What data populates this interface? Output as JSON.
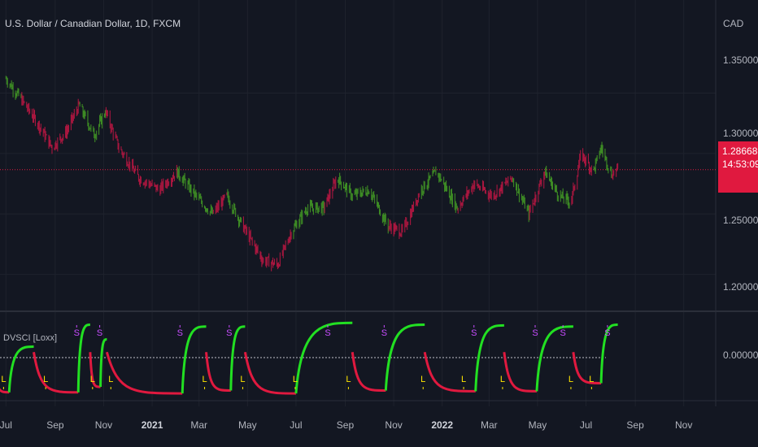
{
  "header": {
    "title": "U.S. Dollar / Canadian Dollar, 1D, FXCM",
    "currency": "CAD"
  },
  "indicator": {
    "title": "DVSCI [Loxx]",
    "sell_marker": "S",
    "buy_marker": "L"
  },
  "last_price": {
    "value": "1.28668",
    "countdown": "14:53:09",
    "color": "#e0193f"
  },
  "colors": {
    "background": "#131722",
    "bull": "#3d8b24",
    "bear": "#a8173f",
    "osc_bull": "#22e022",
    "osc_bear": "#e0193f",
    "sell_marker": "#c84cff",
    "buy_marker": "#ffe600"
  },
  "chart_data": [
    {
      "type": "ohlc",
      "title": "U.S. Dollar / Canadian Dollar, 1D, FXCM",
      "ylabel": "CAD",
      "ylim": [
        1.185,
        1.39
      ],
      "y_ticks": [
        "1.35000",
        "1.30000",
        "1.25000",
        "1.20000"
      ],
      "x_ticks": [
        {
          "label": "Jul",
          "bold": false
        },
        {
          "label": "Sep",
          "bold": false
        },
        {
          "label": "Nov",
          "bold": false
        },
        {
          "label": "2021",
          "bold": true
        },
        {
          "label": "Mar",
          "bold": false
        },
        {
          "label": "May",
          "bold": false
        },
        {
          "label": "Jul",
          "bold": false
        },
        {
          "label": "Sep",
          "bold": false
        },
        {
          "label": "Nov",
          "bold": false
        },
        {
          "label": "2022",
          "bold": true
        },
        {
          "label": "Mar",
          "bold": false
        },
        {
          "label": "May",
          "bold": false
        },
        {
          "label": "Jul",
          "bold": false
        },
        {
          "label": "Sep",
          "bold": false
        },
        {
          "label": "Nov",
          "bold": false
        }
      ],
      "last_value": 1.28668,
      "series_path": [
        [
          "2020-07-01",
          1.362,
          "bull"
        ],
        [
          "2020-07-20",
          1.345,
          "bear"
        ],
        [
          "2020-08-10",
          1.325,
          "bear"
        ],
        [
          "2020-08-28",
          1.305,
          "bear"
        ],
        [
          "2020-09-15",
          1.318,
          "bear"
        ],
        [
          "2020-10-01",
          1.34,
          "bull"
        ],
        [
          "2020-10-20",
          1.315,
          "bull"
        ],
        [
          "2020-11-03",
          1.335,
          "bear"
        ],
        [
          "2020-11-20",
          1.305,
          "bear"
        ],
        [
          "2020-12-15",
          1.28,
          "bear"
        ],
        [
          "2021-01-10",
          1.27,
          "bear"
        ],
        [
          "2021-02-01",
          1.285,
          "bull"
        ],
        [
          "2021-02-25",
          1.265,
          "bull"
        ],
        [
          "2021-03-18",
          1.25,
          "bear"
        ],
        [
          "2021-04-05",
          1.265,
          "bull"
        ],
        [
          "2021-04-25",
          1.24,
          "bear"
        ],
        [
          "2021-05-20",
          1.212,
          "bear"
        ],
        [
          "2021-06-08",
          1.208,
          "bear"
        ],
        [
          "2021-06-25",
          1.235,
          "bull"
        ],
        [
          "2021-07-15",
          1.255,
          "bull"
        ],
        [
          "2021-08-05",
          1.255,
          "bear"
        ],
        [
          "2021-08-22",
          1.28,
          "bull"
        ],
        [
          "2021-09-10",
          1.265,
          "bull"
        ],
        [
          "2021-10-01",
          1.27,
          "bull"
        ],
        [
          "2021-10-25",
          1.24,
          "bear"
        ],
        [
          "2021-11-12",
          1.235,
          "bear"
        ],
        [
          "2021-12-05",
          1.27,
          "bull"
        ],
        [
          "2021-12-25",
          1.285,
          "bull"
        ],
        [
          "2022-01-20",
          1.255,
          "bear"
        ],
        [
          "2022-02-10",
          1.275,
          "bear"
        ],
        [
          "2022-03-05",
          1.265,
          "bear"
        ],
        [
          "2022-03-30",
          1.28,
          "bull"
        ],
        [
          "2022-04-20",
          1.25,
          "bear"
        ],
        [
          "2022-05-10",
          1.285,
          "bull"
        ],
        [
          "2022-05-28",
          1.265,
          "bull"
        ],
        [
          "2022-06-12",
          1.26,
          "bear"
        ],
        [
          "2022-06-25",
          1.3,
          "bear"
        ],
        [
          "2022-07-10",
          1.285,
          "bull"
        ],
        [
          "2022-07-20",
          1.305,
          "bull"
        ],
        [
          "2022-08-02",
          1.283,
          "bear"
        ],
        [
          "2022-08-10",
          1.287,
          "bear"
        ]
      ]
    },
    {
      "type": "line",
      "title": "DVSCI [Loxx]",
      "ylim": [
        -1,
        1
      ],
      "y_ticks": [
        "0.00000"
      ],
      "zero_line": 0,
      "cycles": [
        {
          "start": "2020-06-15",
          "turn": "2020-07-05",
          "end": "2020-08-05",
          "low": -0.95,
          "high": 0.3
        },
        {
          "start": "2020-08-05",
          "turn": "2020-09-30",
          "end": "2020-10-15",
          "low": -0.95,
          "high": 0.9
        },
        {
          "start": "2020-10-15",
          "turn": "2020-10-28",
          "end": "2020-11-05",
          "low": -0.8,
          "high": 0.5
        },
        {
          "start": "2020-11-05",
          "turn": "2021-02-08",
          "end": "2021-03-10",
          "low": -0.98,
          "high": 0.85
        },
        {
          "start": "2021-03-10",
          "turn": "2021-04-10",
          "end": "2021-04-28",
          "low": -0.9,
          "high": 0.85
        },
        {
          "start": "2021-04-28",
          "turn": "2021-07-01",
          "end": "2021-09-10",
          "low": -0.98,
          "high": 0.95
        },
        {
          "start": "2021-09-10",
          "turn": "2021-10-22",
          "end": "2021-12-10",
          "low": -0.9,
          "high": 0.9
        },
        {
          "start": "2021-12-10",
          "turn": "2022-02-12",
          "end": "2022-03-20",
          "low": -0.92,
          "high": 0.88
        },
        {
          "start": "2022-03-20",
          "turn": "2022-04-30",
          "end": "2022-06-15",
          "low": -0.92,
          "high": 0.85
        },
        {
          "start": "2022-06-15",
          "turn": "2022-07-20",
          "end": "2022-08-10",
          "low": -0.7,
          "high": 0.9
        }
      ],
      "sell_signals": [
        "2020-09-28",
        "2020-10-27",
        "2021-02-05",
        "2021-04-08",
        "2021-08-10",
        "2021-10-20",
        "2022-02-10",
        "2022-04-28",
        "2022-06-02",
        "2022-07-28"
      ],
      "buy_signals": [
        "2020-06-28",
        "2020-08-20",
        "2020-10-18",
        "2020-11-10",
        "2021-03-08",
        "2021-04-25",
        "2021-06-30",
        "2021-09-05",
        "2021-12-08",
        "2022-01-28",
        "2022-03-18",
        "2022-06-12",
        "2022-07-08"
      ]
    }
  ]
}
